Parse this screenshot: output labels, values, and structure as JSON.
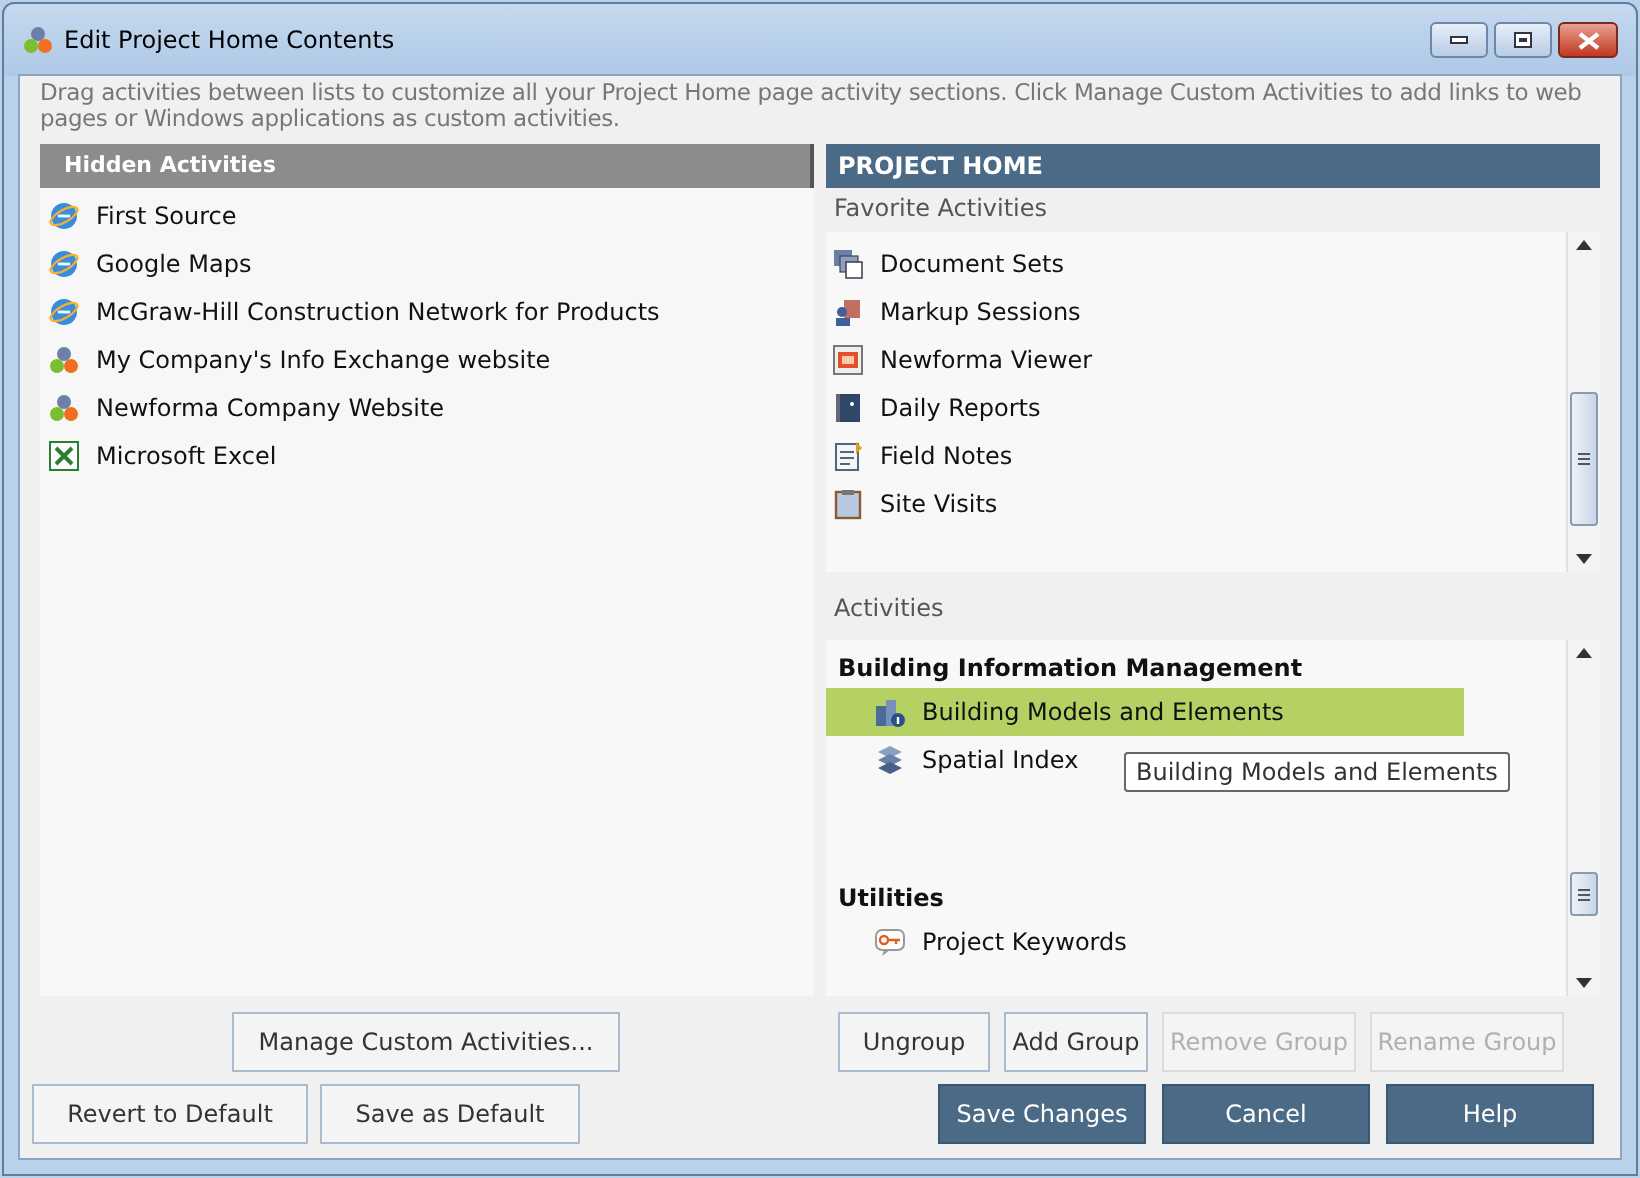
{
  "window": {
    "title": "Edit Project Home Contents"
  },
  "description": "Drag activities between lists to customize all your Project Home page activity sections.  Click Manage Custom Activities to add links to web pages or Windows applications as custom activities.",
  "hidden_activities": {
    "title": "Hidden Activities",
    "items": [
      {
        "label": "First Source",
        "kind": "web"
      },
      {
        "label": "Google Maps",
        "kind": "web"
      },
      {
        "label": "McGraw-Hill Construction Network for Products",
        "kind": "web"
      },
      {
        "label": "My Company's Info Exchange website",
        "kind": "app"
      },
      {
        "label": "Newforma Company Website",
        "kind": "app"
      },
      {
        "label": "Microsoft Excel",
        "kind": "excel"
      }
    ]
  },
  "project_home": {
    "title": "PROJECT HOME",
    "favorites": {
      "title": "Favorite Activities",
      "items": [
        {
          "label": "Document Sets",
          "kind": "docs"
        },
        {
          "label": "Markup Sessions",
          "kind": "markup"
        },
        {
          "label": "Newforma Viewer",
          "kind": "viewer"
        },
        {
          "label": "Daily Reports",
          "kind": "report"
        },
        {
          "label": "Field Notes",
          "kind": "notes"
        },
        {
          "label": "Site Visits",
          "kind": "clipboard"
        }
      ]
    },
    "activities": {
      "title": "Activities",
      "groups": [
        {
          "name": "Building Information Management",
          "items": [
            {
              "label": "Building Models and Elements",
              "kind": "building",
              "selected": true
            },
            {
              "label": "Spatial Index",
              "kind": "spatial",
              "selected": false
            }
          ]
        },
        {
          "name": "Utilities",
          "items": [
            {
              "label": "Project Keywords",
              "kind": "keyword",
              "selected": false
            }
          ]
        }
      ]
    },
    "tooltip": "Building Models and Elements"
  },
  "buttons_left": [
    {
      "label": "Manage Custom Activities...",
      "disabled": false
    }
  ],
  "buttons_group": [
    {
      "label": "Ungroup",
      "disabled": false
    },
    {
      "label": "Add Group",
      "disabled": false
    },
    {
      "label": "Remove Group",
      "disabled": true
    },
    {
      "label": "Rename Group",
      "disabled": true
    }
  ],
  "buttons_default": [
    {
      "label": "Revert to Default"
    },
    {
      "label": "Save as Default"
    }
  ],
  "buttons_main": [
    {
      "label": "Save Changes"
    },
    {
      "label": "Cancel"
    },
    {
      "label": "Help"
    }
  ]
}
